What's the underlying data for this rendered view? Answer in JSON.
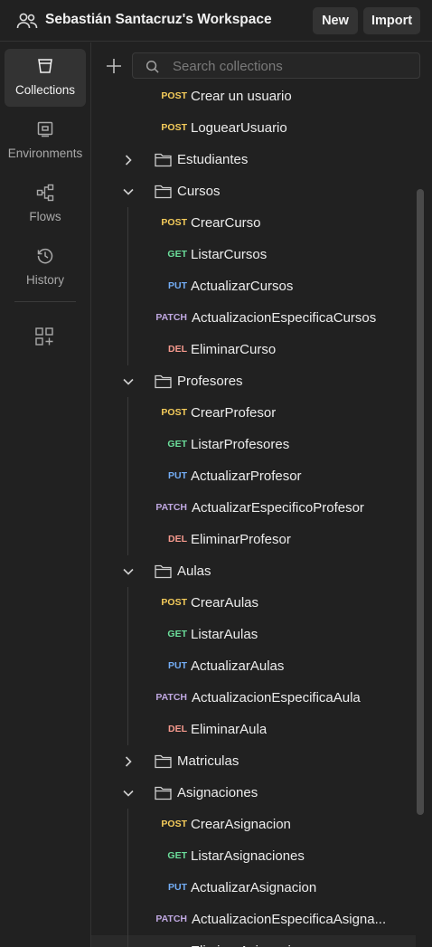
{
  "header": {
    "workspace_title": "Sebastián Santacruz's Workspace",
    "new_label": "New",
    "import_label": "Import",
    "workspace_icon": "team-icon"
  },
  "sidebar": {
    "items": [
      {
        "label": "Collections",
        "icon": "collections-icon",
        "active": true
      },
      {
        "label": "Environments",
        "icon": "environments-icon",
        "active": false
      },
      {
        "label": "Flows",
        "icon": "flows-icon",
        "active": false
      },
      {
        "label": "History",
        "icon": "history-icon",
        "active": false
      }
    ],
    "extra_icon": "add-apps-icon"
  },
  "search": {
    "placeholder": "Search collections"
  },
  "colors": {
    "post": "#f5cc5b",
    "get": "#6bdd9a",
    "put": "#74aef6",
    "patch": "#c0a8e1",
    "del": "#f79a8e"
  },
  "tree": {
    "rows": [
      {
        "type": "request",
        "method": "POST",
        "name": "Crear un usuario"
      },
      {
        "type": "request",
        "method": "POST",
        "name": "LoguearUsuario"
      },
      {
        "type": "folder",
        "name": "Estudiantes",
        "expanded": false
      },
      {
        "type": "folder",
        "name": "Cursos",
        "expanded": true
      },
      {
        "type": "request",
        "method": "POST",
        "name": "CrearCurso"
      },
      {
        "type": "request",
        "method": "GET",
        "name": "ListarCursos"
      },
      {
        "type": "request",
        "method": "PUT",
        "name": "ActualizarCursos"
      },
      {
        "type": "request",
        "method": "PATCH",
        "name": "ActualizacionEspecificaCursos"
      },
      {
        "type": "request",
        "method": "DEL",
        "name": "EliminarCurso"
      },
      {
        "type": "folder",
        "name": "Profesores",
        "expanded": true
      },
      {
        "type": "request",
        "method": "POST",
        "name": "CrearProfesor"
      },
      {
        "type": "request",
        "method": "GET",
        "name": "ListarProfesores"
      },
      {
        "type": "request",
        "method": "PUT",
        "name": "ActualizarProfesor"
      },
      {
        "type": "request",
        "method": "PATCH",
        "name": "ActualizarEspecificoProfesor"
      },
      {
        "type": "request",
        "method": "DEL",
        "name": "EliminarProfesor"
      },
      {
        "type": "folder",
        "name": "Aulas",
        "expanded": true
      },
      {
        "type": "request",
        "method": "POST",
        "name": "CrearAulas"
      },
      {
        "type": "request",
        "method": "GET",
        "name": "ListarAulas"
      },
      {
        "type": "request",
        "method": "PUT",
        "name": "ActualizarAulas"
      },
      {
        "type": "request",
        "method": "PATCH",
        "name": "ActualizacionEspecificaAula"
      },
      {
        "type": "request",
        "method": "DEL",
        "name": "EliminarAula"
      },
      {
        "type": "folder",
        "name": "Matriculas",
        "expanded": false
      },
      {
        "type": "folder",
        "name": "Asignaciones",
        "expanded": true
      },
      {
        "type": "request",
        "method": "POST",
        "name": "CrearAsignacion"
      },
      {
        "type": "request",
        "method": "GET",
        "name": "ListarAsignaciones"
      },
      {
        "type": "request",
        "method": "PUT",
        "name": "ActualizarAsignacion"
      },
      {
        "type": "request",
        "method": "PATCH",
        "name": "ActualizacionEspecificaAsigna..."
      },
      {
        "type": "request",
        "method": "DEL",
        "name": "EliminarAsignacion",
        "selected": true
      }
    ]
  }
}
